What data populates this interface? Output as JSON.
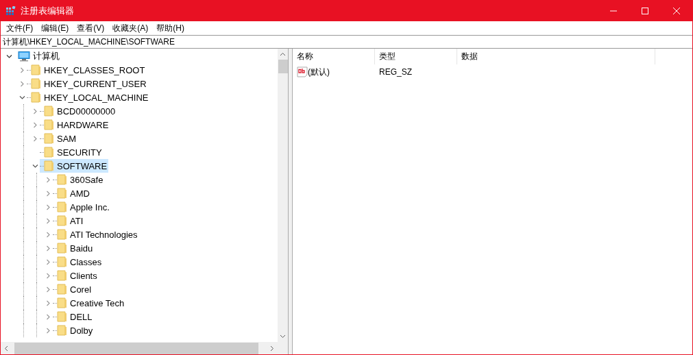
{
  "window": {
    "title": "注册表编辑器"
  },
  "menu": [
    "文件(F)",
    "编辑(E)",
    "查看(V)",
    "收藏夹(A)",
    "帮助(H)"
  ],
  "address": {
    "value": "计算机\\HKEY_LOCAL_MACHINE\\SOFTWARE"
  },
  "tree": [
    {
      "label": "计算机",
      "kind": "computer",
      "expanded": true,
      "selected": false,
      "children": [
        {
          "label": "HKEY_CLASSES_ROOT",
          "kind": "branch",
          "expanded": false,
          "selected": false
        },
        {
          "label": "HKEY_CURRENT_USER",
          "kind": "branch",
          "expanded": false,
          "selected": false
        },
        {
          "label": "HKEY_LOCAL_MACHINE",
          "kind": "branch",
          "expanded": true,
          "selected": false,
          "children": [
            {
              "label": "BCD00000000",
              "kind": "branch",
              "expanded": false,
              "selected": false
            },
            {
              "label": "HARDWARE",
              "kind": "branch",
              "expanded": false,
              "selected": false
            },
            {
              "label": "SAM",
              "kind": "branch",
              "expanded": false,
              "selected": false
            },
            {
              "label": "SECURITY",
              "kind": "leaf",
              "selected": false
            },
            {
              "label": "SOFTWARE",
              "kind": "branch",
              "expanded": true,
              "selected": true,
              "children": [
                {
                  "label": "360Safe",
                  "kind": "branch",
                  "expanded": false,
                  "selected": false
                },
                {
                  "label": "AMD",
                  "kind": "branch",
                  "expanded": false,
                  "selected": false
                },
                {
                  "label": "Apple Inc.",
                  "kind": "branch",
                  "expanded": false,
                  "selected": false
                },
                {
                  "label": "ATI",
                  "kind": "branch",
                  "expanded": false,
                  "selected": false
                },
                {
                  "label": "ATI Technologies",
                  "kind": "branch",
                  "expanded": false,
                  "selected": false
                },
                {
                  "label": "Baidu",
                  "kind": "branch",
                  "expanded": false,
                  "selected": false
                },
                {
                  "label": "Classes",
                  "kind": "branch",
                  "expanded": false,
                  "selected": false
                },
                {
                  "label": "Clients",
                  "kind": "branch",
                  "expanded": false,
                  "selected": false
                },
                {
                  "label": "Corel",
                  "kind": "branch",
                  "expanded": false,
                  "selected": false
                },
                {
                  "label": "Creative Tech",
                  "kind": "branch",
                  "expanded": false,
                  "selected": false
                },
                {
                  "label": "DELL",
                  "kind": "branch",
                  "expanded": false,
                  "selected": false
                },
                {
                  "label": "Dolby",
                  "kind": "branch",
                  "expanded": false,
                  "selected": false
                }
              ]
            }
          ]
        }
      ]
    }
  ],
  "table": {
    "columns": [
      "名称",
      "类型",
      "数据"
    ],
    "rows": [
      {
        "name": "(默认)",
        "type": "REG_SZ",
        "kind": "string"
      }
    ]
  }
}
